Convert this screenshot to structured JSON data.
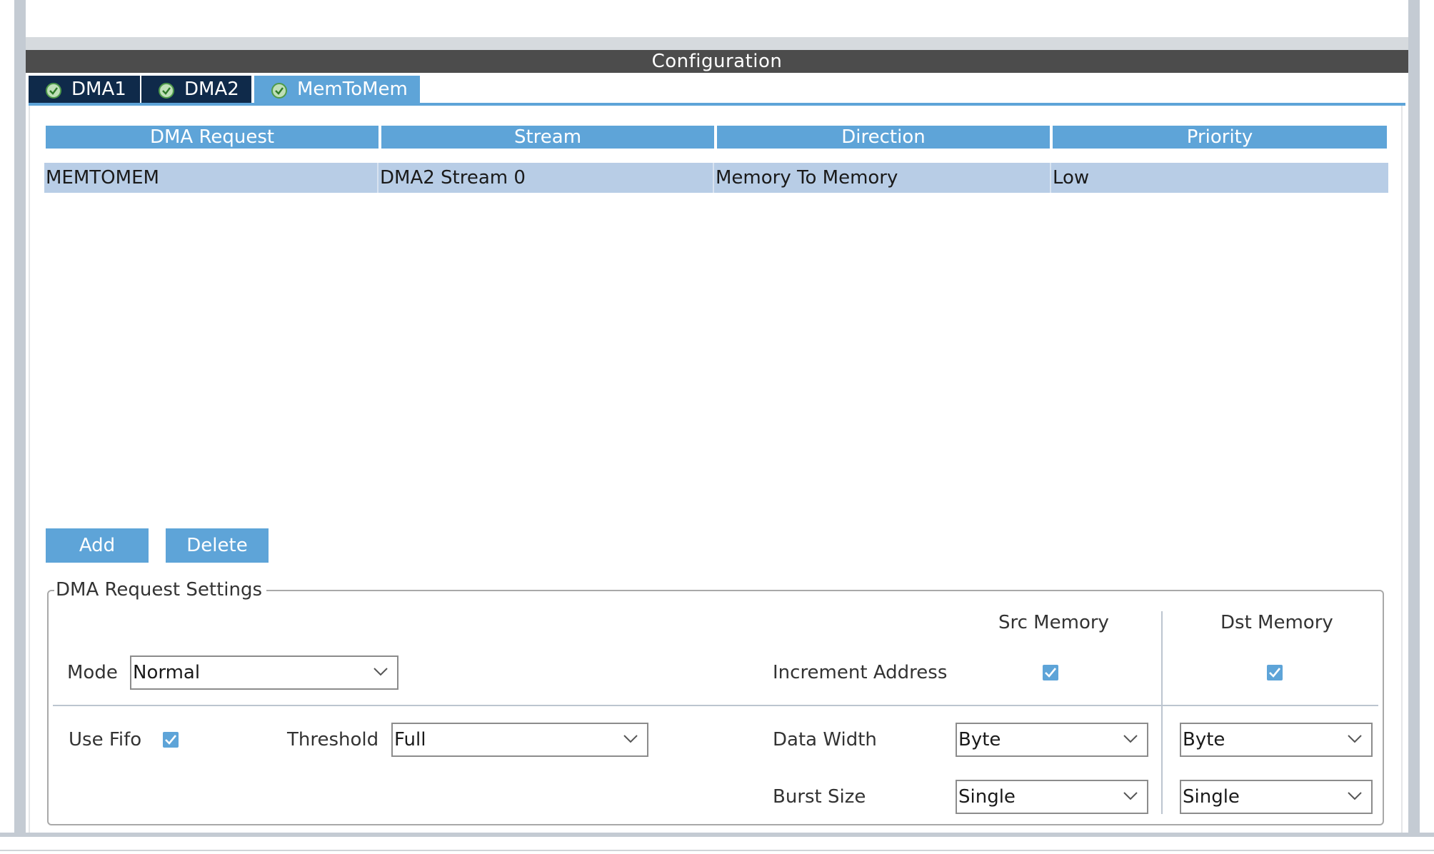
{
  "window": {
    "title": "Configuration"
  },
  "tabs": [
    {
      "label": "DMA1",
      "icon": "check-circle-icon",
      "active": false
    },
    {
      "label": "DMA2",
      "icon": "check-circle-icon",
      "active": false
    },
    {
      "label": "MemToMem",
      "icon": "check-circle-icon",
      "active": true
    }
  ],
  "table": {
    "columns": [
      "DMA Request",
      "Stream",
      "Direction",
      "Priority"
    ],
    "rows": [
      [
        "MEMTOMEM",
        "DMA2 Stream 0",
        "Memory To Memory",
        "Low"
      ]
    ]
  },
  "buttons": {
    "add": "Add",
    "delete": "Delete"
  },
  "settings": {
    "legend": "DMA Request Settings",
    "col_src": "Src Memory",
    "col_dst": "Dst Memory",
    "mode": {
      "label": "Mode",
      "value": "Normal"
    },
    "increment_address": {
      "label": "Increment Address",
      "src_checked": true,
      "dst_checked": true
    },
    "use_fifo": {
      "label": "Use Fifo",
      "checked": true
    },
    "threshold": {
      "label": "Threshold",
      "value": "Full"
    },
    "data_width": {
      "label": "Data Width",
      "src": "Byte",
      "dst": "Byte"
    },
    "burst_size": {
      "label": "Burst Size",
      "src": "Single",
      "dst": "Single"
    }
  },
  "colors": {
    "accent": "#5ea4d8",
    "tab_inactive": "#0f2a4a",
    "title_bar": "#4c4c4c",
    "selected_row": "#b8cde6"
  }
}
